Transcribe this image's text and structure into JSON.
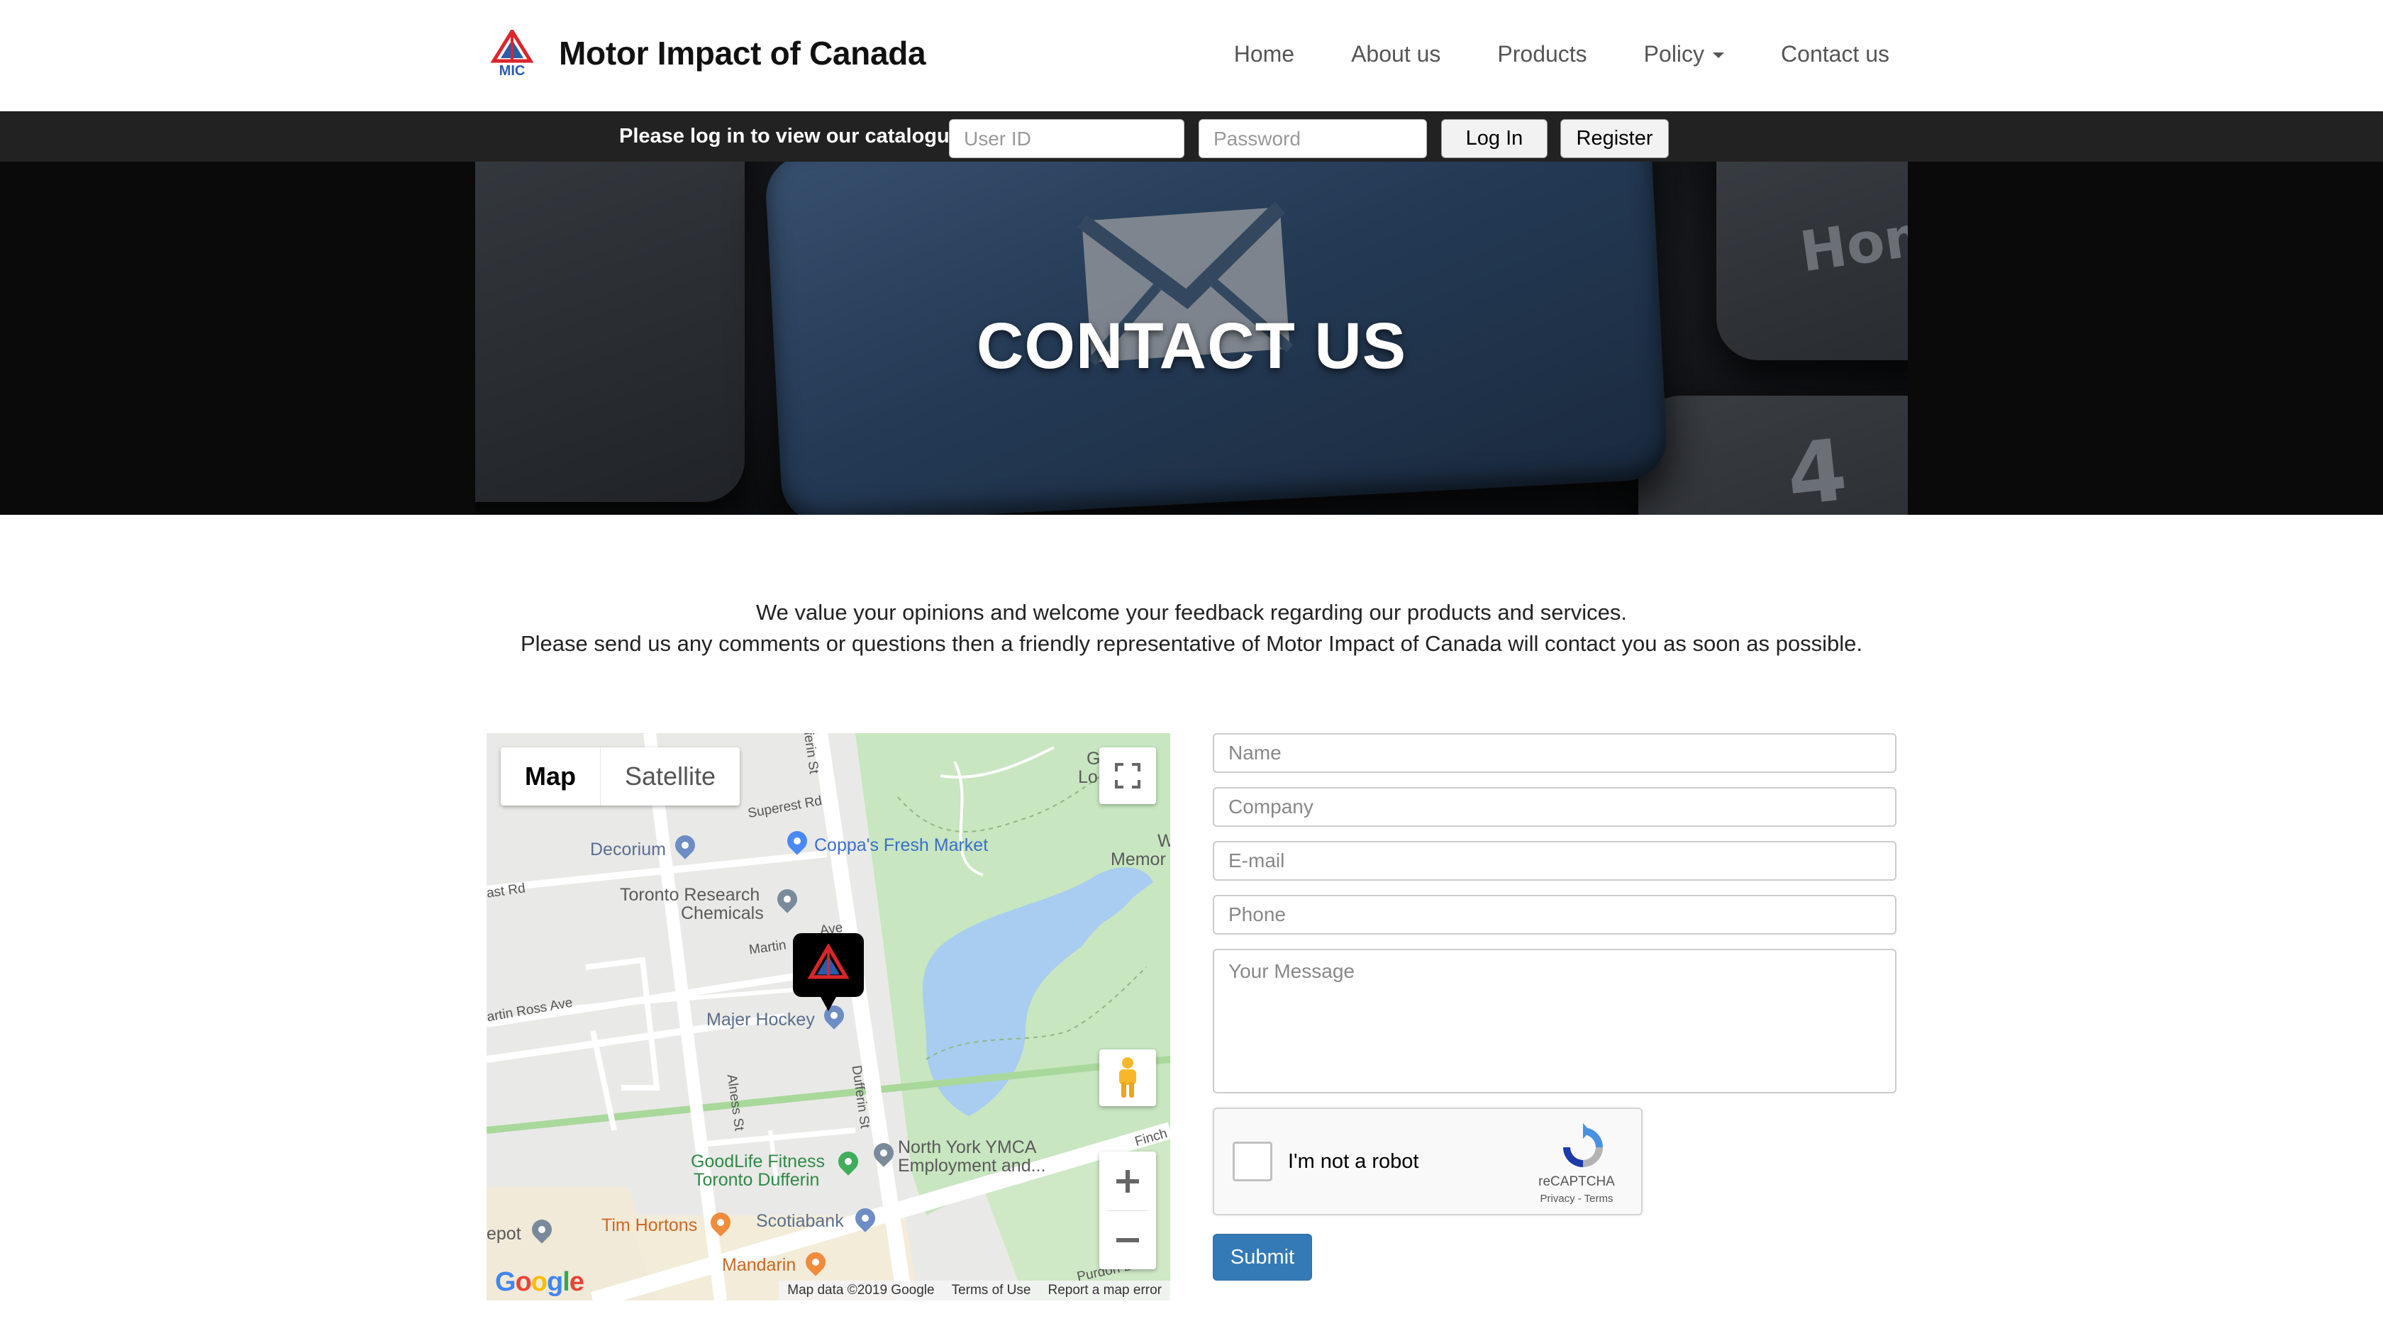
{
  "brand": {
    "name": "Motor Impact of Canada",
    "logo_text": "MIC"
  },
  "nav": {
    "home": "Home",
    "about": "About us",
    "products": "Products",
    "policy": "Policy",
    "contact": "Contact us"
  },
  "login": {
    "prompt": "Please log in to view our catalogue",
    "user_placeholder": "User ID",
    "password_placeholder": "Password",
    "login_label": "Log In",
    "register_label": "Register"
  },
  "hero": {
    "title": "CONTACT US",
    "key_glyph_top": "Hom",
    "key_glyph_bottom": "4"
  },
  "intro": {
    "line1": "We value your opinions and welcome your feedback regarding our products and services.",
    "line2": "Please send us any comments or questions then a friendly representative of Motor Impact of Canada will contact you as soon as possible."
  },
  "map": {
    "type_map": "Map",
    "type_satellite": "Satellite",
    "labels": {
      "decorium": "Decorium",
      "coppas": "Coppa's Fresh Market",
      "toronto_research_1": "Toronto Research",
      "toronto_research_2": "Chemicals",
      "majer": "Majer Hockey",
      "ymca_1": "North York YMCA",
      "ymca_2": "Employment and...",
      "goodlife_1": "GoodLife Fitness",
      "goodlife_2": "Toronto Dufferin",
      "tim": "Tim Hortons",
      "scotiabank": "Scotiabank",
      "mandarin": "Mandarin",
      "depot": "epot",
      "memorial": "Memor",
      "g_lo_1": "G",
      "g_lo_2": "Lo",
      "w": "W"
    },
    "roads": {
      "dufferin_top": "fferin St",
      "superest": "Superest Rd",
      "east_rd": "ast Rd",
      "martin": "Martin",
      "ave": "Ave",
      "martin_ross": "artin Ross Ave",
      "alness": "Alness St",
      "dufferin": "Dufferin St",
      "finch": "Finch",
      "purdon": "Purdon Dr"
    },
    "google": "Google",
    "attribution": "Map data ©2019 Google",
    "terms": "Terms of Use",
    "report": "Report a map error"
  },
  "form": {
    "name_placeholder": "Name",
    "company_placeholder": "Company",
    "email_placeholder": "E-mail",
    "phone_placeholder": "Phone",
    "message_placeholder": "Your Message",
    "recaptcha_label": "I'm not a robot",
    "recaptcha_brand": "reCAPTCHA",
    "recaptcha_terms": "Privacy - Terms",
    "submit_label": "Submit"
  },
  "colors": {
    "brand_red": "#d9262c",
    "brand_blue": "#2a5caa",
    "submit": "#337ab7",
    "login_bar": "#222222",
    "park_green": "#c8e6c0",
    "water": "#a8cdf0"
  }
}
